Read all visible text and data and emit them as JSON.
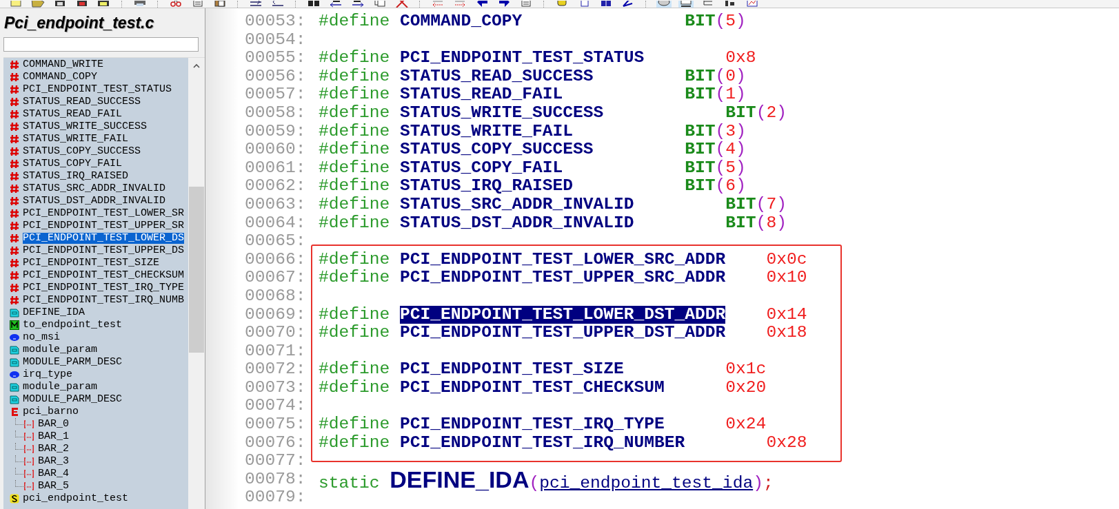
{
  "sidebar": {
    "title": "Pci_endpoint_test.c",
    "items": [
      {
        "label": "COMMAND_WRITE",
        "kind": "define",
        "selected": false
      },
      {
        "label": "COMMAND_COPY",
        "kind": "define",
        "selected": false
      },
      {
        "label": "PCI_ENDPOINT_TEST_STATUS",
        "kind": "define",
        "selected": false
      },
      {
        "label": "STATUS_READ_SUCCESS",
        "kind": "define",
        "selected": false
      },
      {
        "label": "STATUS_READ_FAIL",
        "kind": "define",
        "selected": false
      },
      {
        "label": "STATUS_WRITE_SUCCESS",
        "kind": "define",
        "selected": false
      },
      {
        "label": "STATUS_WRITE_FAIL",
        "kind": "define",
        "selected": false
      },
      {
        "label": "STATUS_COPY_SUCCESS",
        "kind": "define",
        "selected": false
      },
      {
        "label": "STATUS_COPY_FAIL",
        "kind": "define",
        "selected": false
      },
      {
        "label": "STATUS_IRQ_RAISED",
        "kind": "define",
        "selected": false
      },
      {
        "label": "STATUS_SRC_ADDR_INVALID",
        "kind": "define",
        "selected": false
      },
      {
        "label": "STATUS_DST_ADDR_INVALID",
        "kind": "define",
        "selected": false
      },
      {
        "label": "PCI_ENDPOINT_TEST_LOWER_SR",
        "kind": "define",
        "selected": false
      },
      {
        "label": "PCI_ENDPOINT_TEST_UPPER_SR",
        "kind": "define",
        "selected": false
      },
      {
        "label": "PCI_ENDPOINT_TEST_LOWER_DS",
        "kind": "define",
        "selected": true
      },
      {
        "label": "PCI_ENDPOINT_TEST_UPPER_DS",
        "kind": "define",
        "selected": false
      },
      {
        "label": "PCI_ENDPOINT_TEST_SIZE",
        "kind": "define",
        "selected": false
      },
      {
        "label": "PCI_ENDPOINT_TEST_CHECKSUM",
        "kind": "define",
        "selected": false
      },
      {
        "label": "PCI_ENDPOINT_TEST_IRQ_TYPE",
        "kind": "define",
        "selected": false
      },
      {
        "label": "PCI_ENDPOINT_TEST_IRQ_NUMB",
        "kind": "define",
        "selected": false
      },
      {
        "label": "DEFINE_IDA",
        "kind": "macro_call",
        "selected": false
      },
      {
        "label": "to_endpoint_test",
        "kind": "macro",
        "selected": false
      },
      {
        "label": "no_msi",
        "kind": "variable",
        "selected": false
      },
      {
        "label": "module_param",
        "kind": "macro_call",
        "selected": false
      },
      {
        "label": "MODULE_PARM_DESC",
        "kind": "macro_call",
        "selected": false
      },
      {
        "label": "irq_type",
        "kind": "variable",
        "selected": false
      },
      {
        "label": "module_param",
        "kind": "macro_call",
        "selected": false
      },
      {
        "label": "MODULE_PARM_DESC",
        "kind": "macro_call",
        "selected": false
      },
      {
        "label": "pci_barno",
        "kind": "enum",
        "selected": false,
        "children": [
          {
            "label": "BAR_0",
            "kind": "enum_member",
            "selected": false
          },
          {
            "label": "BAR_1",
            "kind": "enum_member",
            "selected": false
          },
          {
            "label": "BAR_2",
            "kind": "enum_member",
            "selected": false
          },
          {
            "label": "BAR_3",
            "kind": "enum_member",
            "selected": false
          },
          {
            "label": "BAR_4",
            "kind": "enum_member",
            "selected": false
          },
          {
            "label": "BAR_5",
            "kind": "enum_member",
            "selected": false
          }
        ]
      },
      {
        "label": "pci_endpoint_test",
        "kind": "struct",
        "selected": false
      }
    ]
  },
  "editor": {
    "blocks": [
      {
        "boxed": false,
        "lines": [
          {
            "number": "00053:",
            "kind": "define",
            "directive": "#define",
            "name": "COMMAND_COPY",
            "selected": false,
            "value": {
              "kind": "call",
              "name": "BIT",
              "open": "(",
              "arg": "5",
              "close": ")"
            }
          },
          {
            "number": "00054:",
            "kind": "blank"
          },
          {
            "number": "00055:",
            "kind": "define",
            "directive": "#define",
            "name": "PCI_ENDPOINT_TEST_STATUS",
            "selected": false,
            "value": {
              "kind": "hex",
              "text": "0x8"
            }
          },
          {
            "number": "00056:",
            "kind": "define",
            "directive": "#define",
            "name": "STATUS_READ_SUCCESS",
            "selected": false,
            "value": {
              "kind": "call",
              "name": "BIT",
              "open": "(",
              "arg": "0",
              "close": ")"
            }
          },
          {
            "number": "00057:",
            "kind": "define",
            "directive": "#define",
            "name": "STATUS_READ_FAIL",
            "selected": false,
            "value": {
              "kind": "call",
              "name": "BIT",
              "open": "(",
              "arg": "1",
              "close": ")"
            }
          },
          {
            "number": "00058:",
            "kind": "define",
            "directive": "#define",
            "name": "STATUS_WRITE_SUCCESS",
            "selected": false,
            "value": {
              "kind": "call",
              "name": "BIT",
              "open": "(",
              "arg": "2",
              "close": ")"
            }
          },
          {
            "number": "00059:",
            "kind": "define",
            "directive": "#define",
            "name": "STATUS_WRITE_FAIL",
            "selected": false,
            "value": {
              "kind": "call",
              "name": "BIT",
              "open": "(",
              "arg": "3",
              "close": ")"
            }
          },
          {
            "number": "00060:",
            "kind": "define",
            "directive": "#define",
            "name": "STATUS_COPY_SUCCESS",
            "selected": false,
            "value": {
              "kind": "call",
              "name": "BIT",
              "open": "(",
              "arg": "4",
              "close": ")"
            }
          },
          {
            "number": "00061:",
            "kind": "define",
            "directive": "#define",
            "name": "STATUS_COPY_FAIL",
            "selected": false,
            "value": {
              "kind": "call",
              "name": "BIT",
              "open": "(",
              "arg": "5",
              "close": ")"
            }
          },
          {
            "number": "00062:",
            "kind": "define",
            "directive": "#define",
            "name": "STATUS_IRQ_RAISED",
            "selected": false,
            "value": {
              "kind": "call",
              "name": "BIT",
              "open": "(",
              "arg": "6",
              "close": ")"
            }
          },
          {
            "number": "00063:",
            "kind": "define",
            "directive": "#define",
            "name": "STATUS_SRC_ADDR_INVALID",
            "selected": false,
            "value": {
              "kind": "call",
              "name": "BIT",
              "open": "(",
              "arg": "7",
              "close": ")"
            }
          },
          {
            "number": "00064:",
            "kind": "define",
            "directive": "#define",
            "name": "STATUS_DST_ADDR_INVALID",
            "selected": false,
            "value": {
              "kind": "call",
              "name": "BIT",
              "open": "(",
              "arg": "8",
              "close": ")"
            }
          },
          {
            "number": "00065:",
            "kind": "blank"
          }
        ]
      },
      {
        "boxed": true,
        "lines": [
          {
            "number": "00066:",
            "kind": "define",
            "directive": "#define",
            "name": "PCI_ENDPOINT_TEST_LOWER_SRC_ADDR",
            "selected": false,
            "value": {
              "kind": "hex",
              "text": "0x0c"
            }
          },
          {
            "number": "00067:",
            "kind": "define",
            "directive": "#define",
            "name": "PCI_ENDPOINT_TEST_UPPER_SRC_ADDR",
            "selected": false,
            "value": {
              "kind": "hex",
              "text": "0x10"
            }
          },
          {
            "number": "00068:",
            "kind": "blank"
          },
          {
            "number": "00069:",
            "kind": "define",
            "directive": "#define",
            "name": "PCI_ENDPOINT_TEST_LOWER_DST_ADDR",
            "selected": true,
            "value": {
              "kind": "hex",
              "text": "0x14"
            }
          },
          {
            "number": "00070:",
            "kind": "define",
            "directive": "#define",
            "name": "PCI_ENDPOINT_TEST_UPPER_DST_ADDR",
            "selected": false,
            "value": {
              "kind": "hex",
              "text": "0x18"
            }
          },
          {
            "number": "00071:",
            "kind": "blank"
          },
          {
            "number": "00072:",
            "kind": "define",
            "directive": "#define",
            "name": "PCI_ENDPOINT_TEST_SIZE",
            "selected": false,
            "value": {
              "kind": "hex",
              "text": "0x1c"
            }
          },
          {
            "number": "00073:",
            "kind": "define",
            "directive": "#define",
            "name": "PCI_ENDPOINT_TEST_CHECKSUM",
            "selected": false,
            "value": {
              "kind": "hex",
              "text": "0x20"
            }
          },
          {
            "number": "00074:",
            "kind": "blank"
          },
          {
            "number": "00075:",
            "kind": "define",
            "directive": "#define",
            "name": "PCI_ENDPOINT_TEST_IRQ_TYPE",
            "selected": false,
            "value": {
              "kind": "hex",
              "text": "0x24"
            }
          },
          {
            "number": "00076:",
            "kind": "define",
            "directive": "#define",
            "name": "PCI_ENDPOINT_TEST_IRQ_NUMBER",
            "selected": false,
            "value": {
              "kind": "hex",
              "text": "0x28"
            }
          },
          {
            "number": "00077:",
            "kind": "blank"
          }
        ]
      },
      {
        "boxed": false,
        "lines": [
          {
            "number": "00078:",
            "kind": "macro_invocation",
            "keyword": "static",
            "macro": "DEFINE_IDA",
            "open": "(",
            "arg": "pci_endpoint_test_ida",
            "close": ")",
            "end": ";"
          },
          {
            "number": "00079:",
            "kind": "blank"
          }
        ]
      }
    ]
  }
}
